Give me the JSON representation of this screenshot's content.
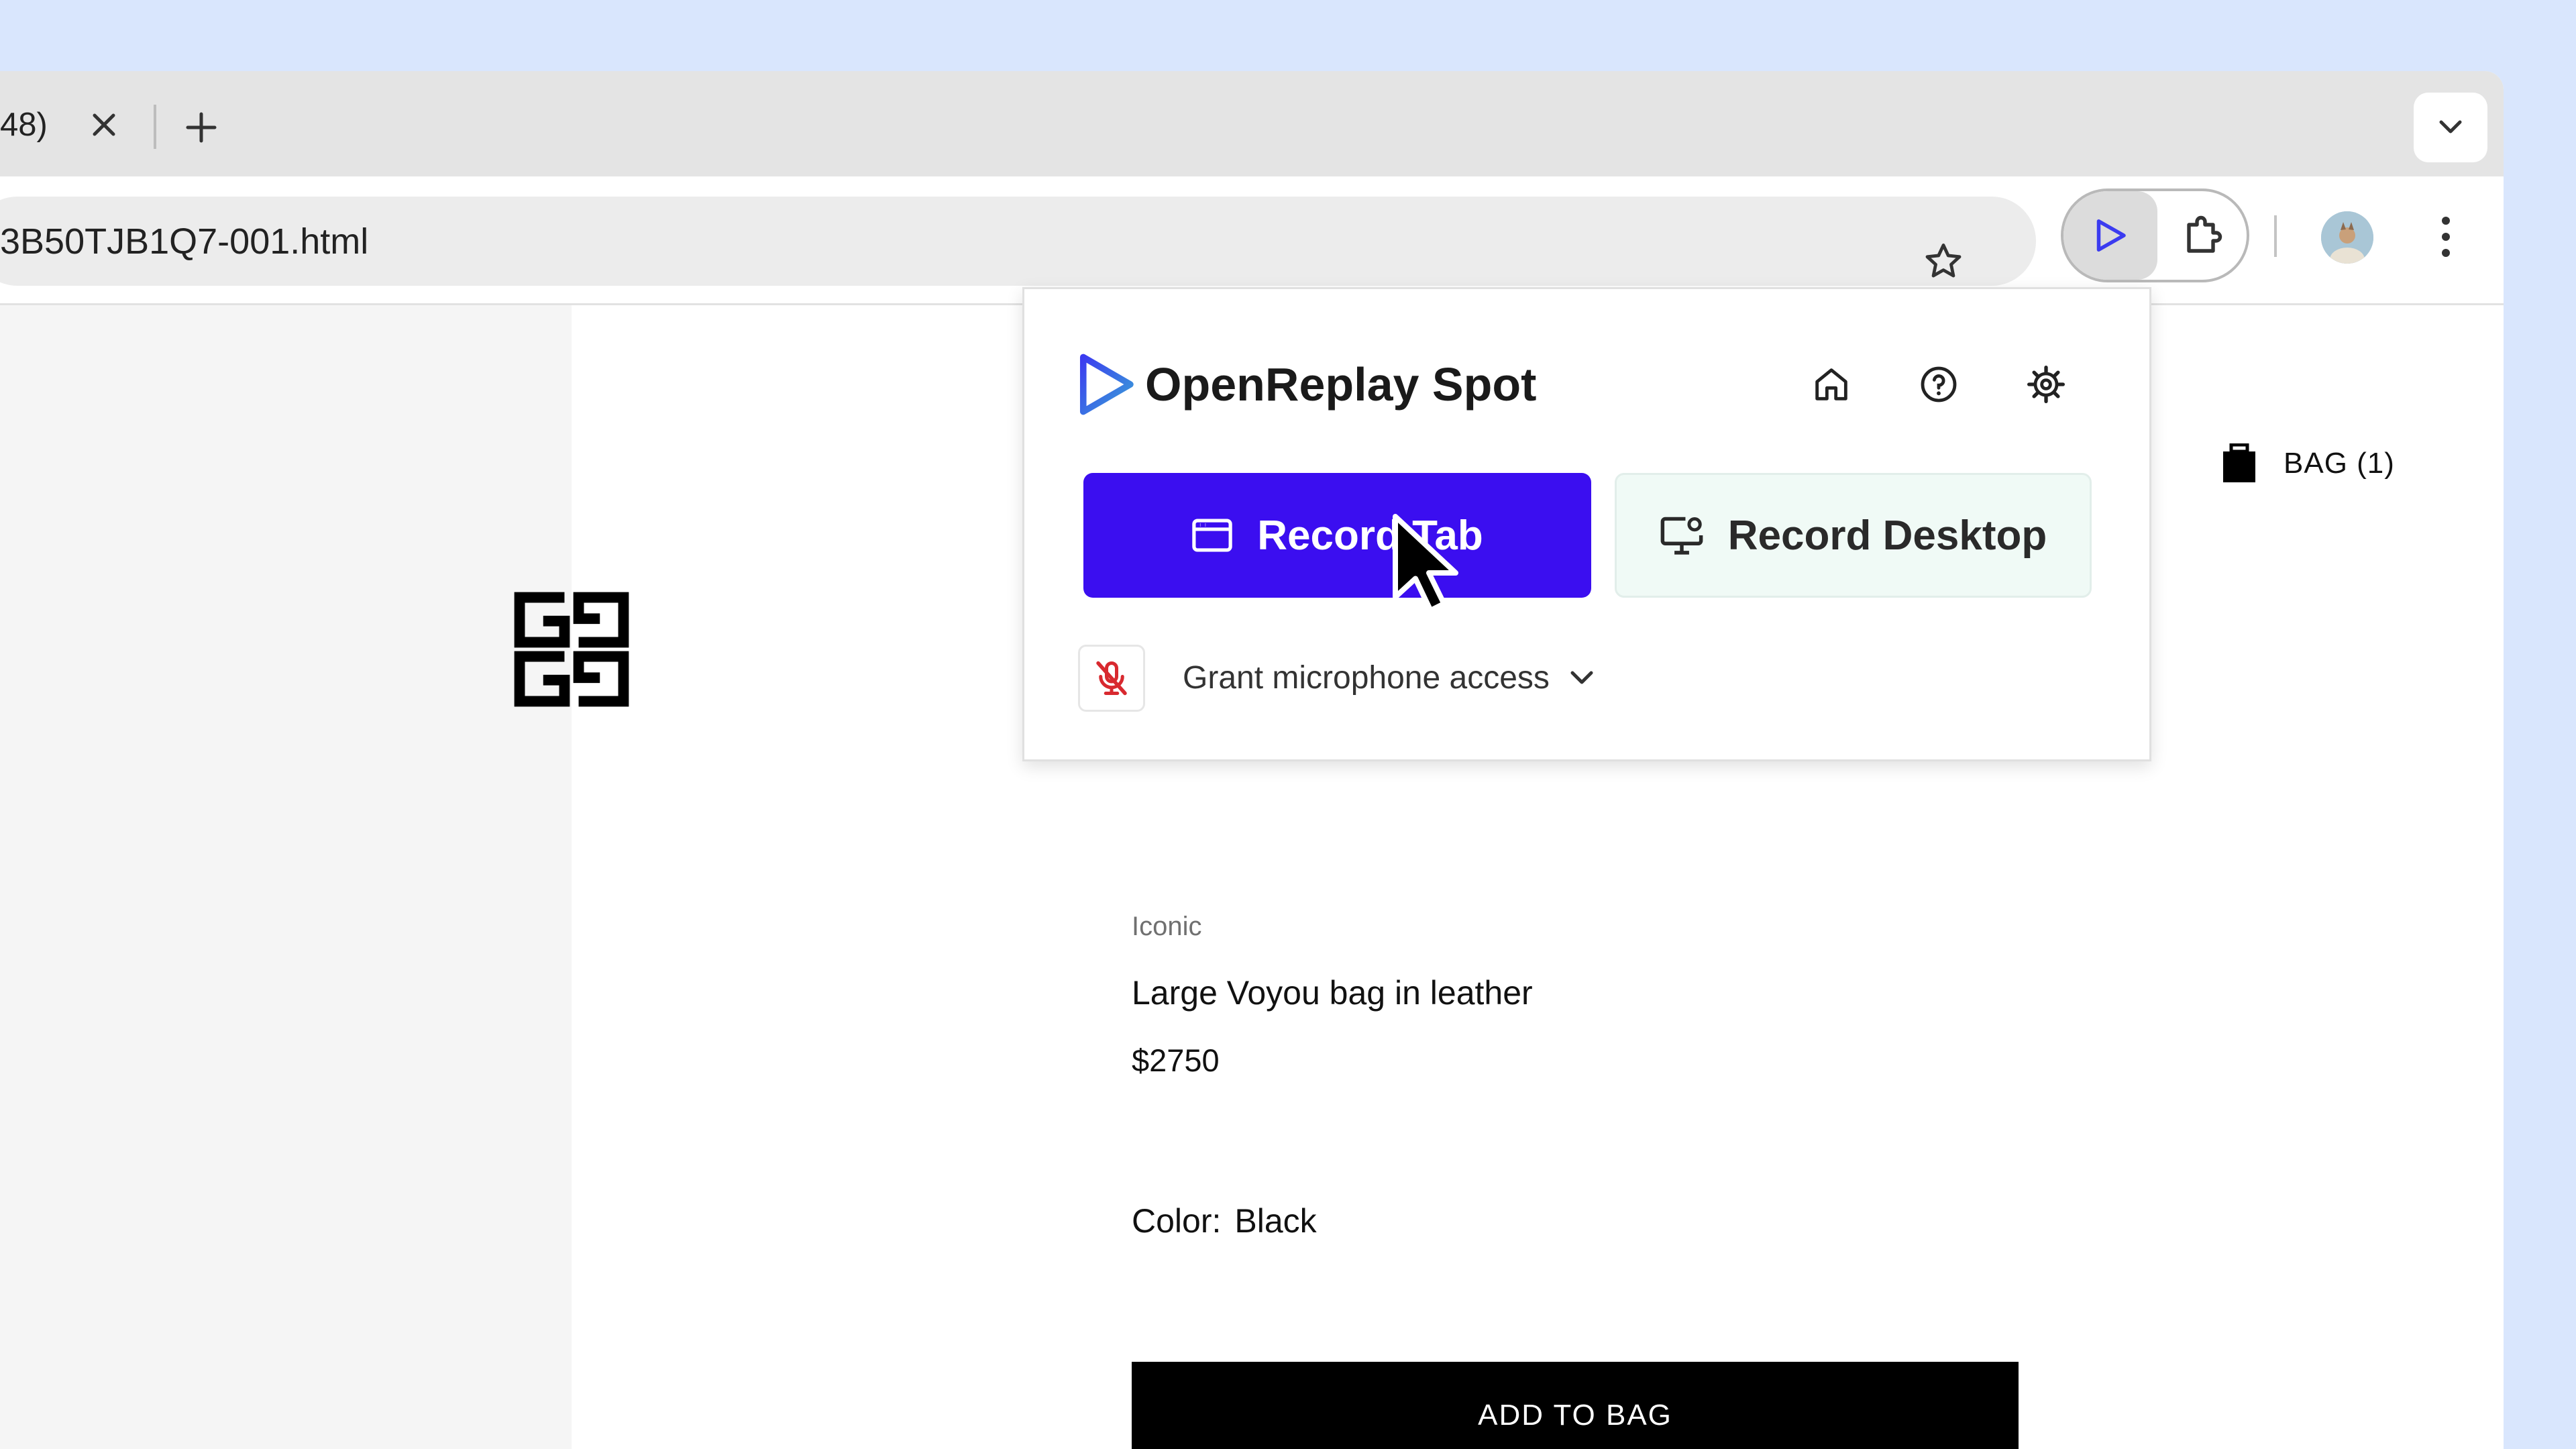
{
  "browser": {
    "tab_title": "48)",
    "url": "3B50TJB1Q7-001.html"
  },
  "store": {
    "bag_label": "BAG (1)",
    "product": {
      "eyebrow": "Iconic",
      "name": "Large Voyou bag in leather",
      "price": "$2750",
      "color_label": "Color:",
      "color_value": "Black",
      "add_button": "ADD TO BAG"
    }
  },
  "popup": {
    "brand": "OpenReplay Spot",
    "record_tab": "Record Tab",
    "record_desktop": "Record Desktop",
    "mic_label": "Grant microphone access"
  },
  "colors": {
    "primary": "#3b0ef0",
    "page_bg": "#d9e6fd",
    "mic_off": "#d8292f"
  }
}
